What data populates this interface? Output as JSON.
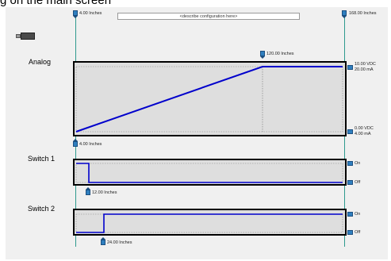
{
  "caption": "g on the main screen",
  "description_placeholder": "<describe configuration here>",
  "markers": {
    "start": "4.00 Inches",
    "end": "168.00 Inches",
    "analog_top": "120.00 Inches",
    "analog_bottom": "4.00 Inches",
    "switch1": "12.00 Inches",
    "switch2": "24.00 Inches"
  },
  "analog": {
    "title": "Analog",
    "top_labels": [
      "10.00 VDC",
      "20.00 mA"
    ],
    "bottom_labels": [
      "0.00 VDC",
      "4.00 mA"
    ]
  },
  "switch1": {
    "title": "Switch 1",
    "on": "On",
    "off": "Off"
  },
  "switch2": {
    "title": "Switch 2",
    "on": "On",
    "off": "Off"
  },
  "colors": {
    "signal": "#0000cc",
    "guide": "#2e9a8e",
    "marker": "#2f7fbf"
  }
}
